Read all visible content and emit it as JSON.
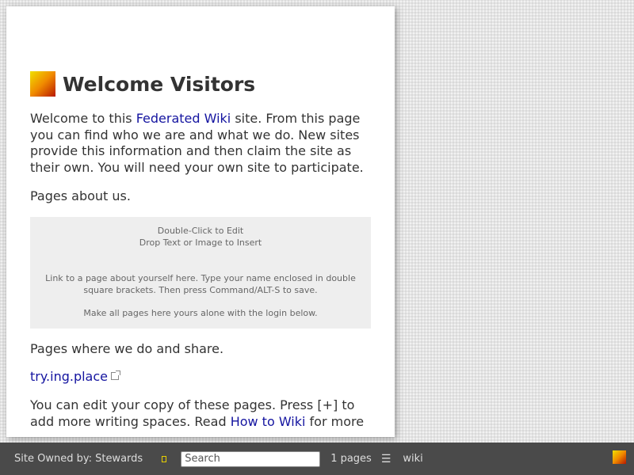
{
  "page": {
    "title": "Welcome Visitors",
    "intro": {
      "before": "Welcome to this ",
      "link": "Federated Wiki",
      "after": " site. From this page you can find who we are and what we do. New sites provide this information and then claim the site as their own. You will need your own site to participate."
    },
    "pages_about_us": "Pages about us.",
    "factory": {
      "hint_line1": "Double-Click to Edit",
      "hint_line2": "Drop Text or Image to Insert",
      "para1": "Link to a page about yourself here. Type your name enclosed in double square brackets. Then press Command/ALT-S to save.",
      "para2": "Make all pages here yours alone with the login below."
    },
    "pages_where": "Pages where we do and share.",
    "external_link": "try.ing.place",
    "edit_note": {
      "before": "You can edit your copy of these pages. Press [+] to add more writing spaces. Read ",
      "link": "How to Wiki",
      "after": " for more"
    }
  },
  "footer": {
    "owner": "Site Owned by: Stewards",
    "search_placeholder": "Search",
    "pages_count": "1 pages",
    "list_icon": "☰",
    "wiki_label": "wiki"
  },
  "colors": {
    "link": "#1414a0",
    "footer_bg": "#4a4a4a",
    "factory_bg": "#eeeeee"
  }
}
